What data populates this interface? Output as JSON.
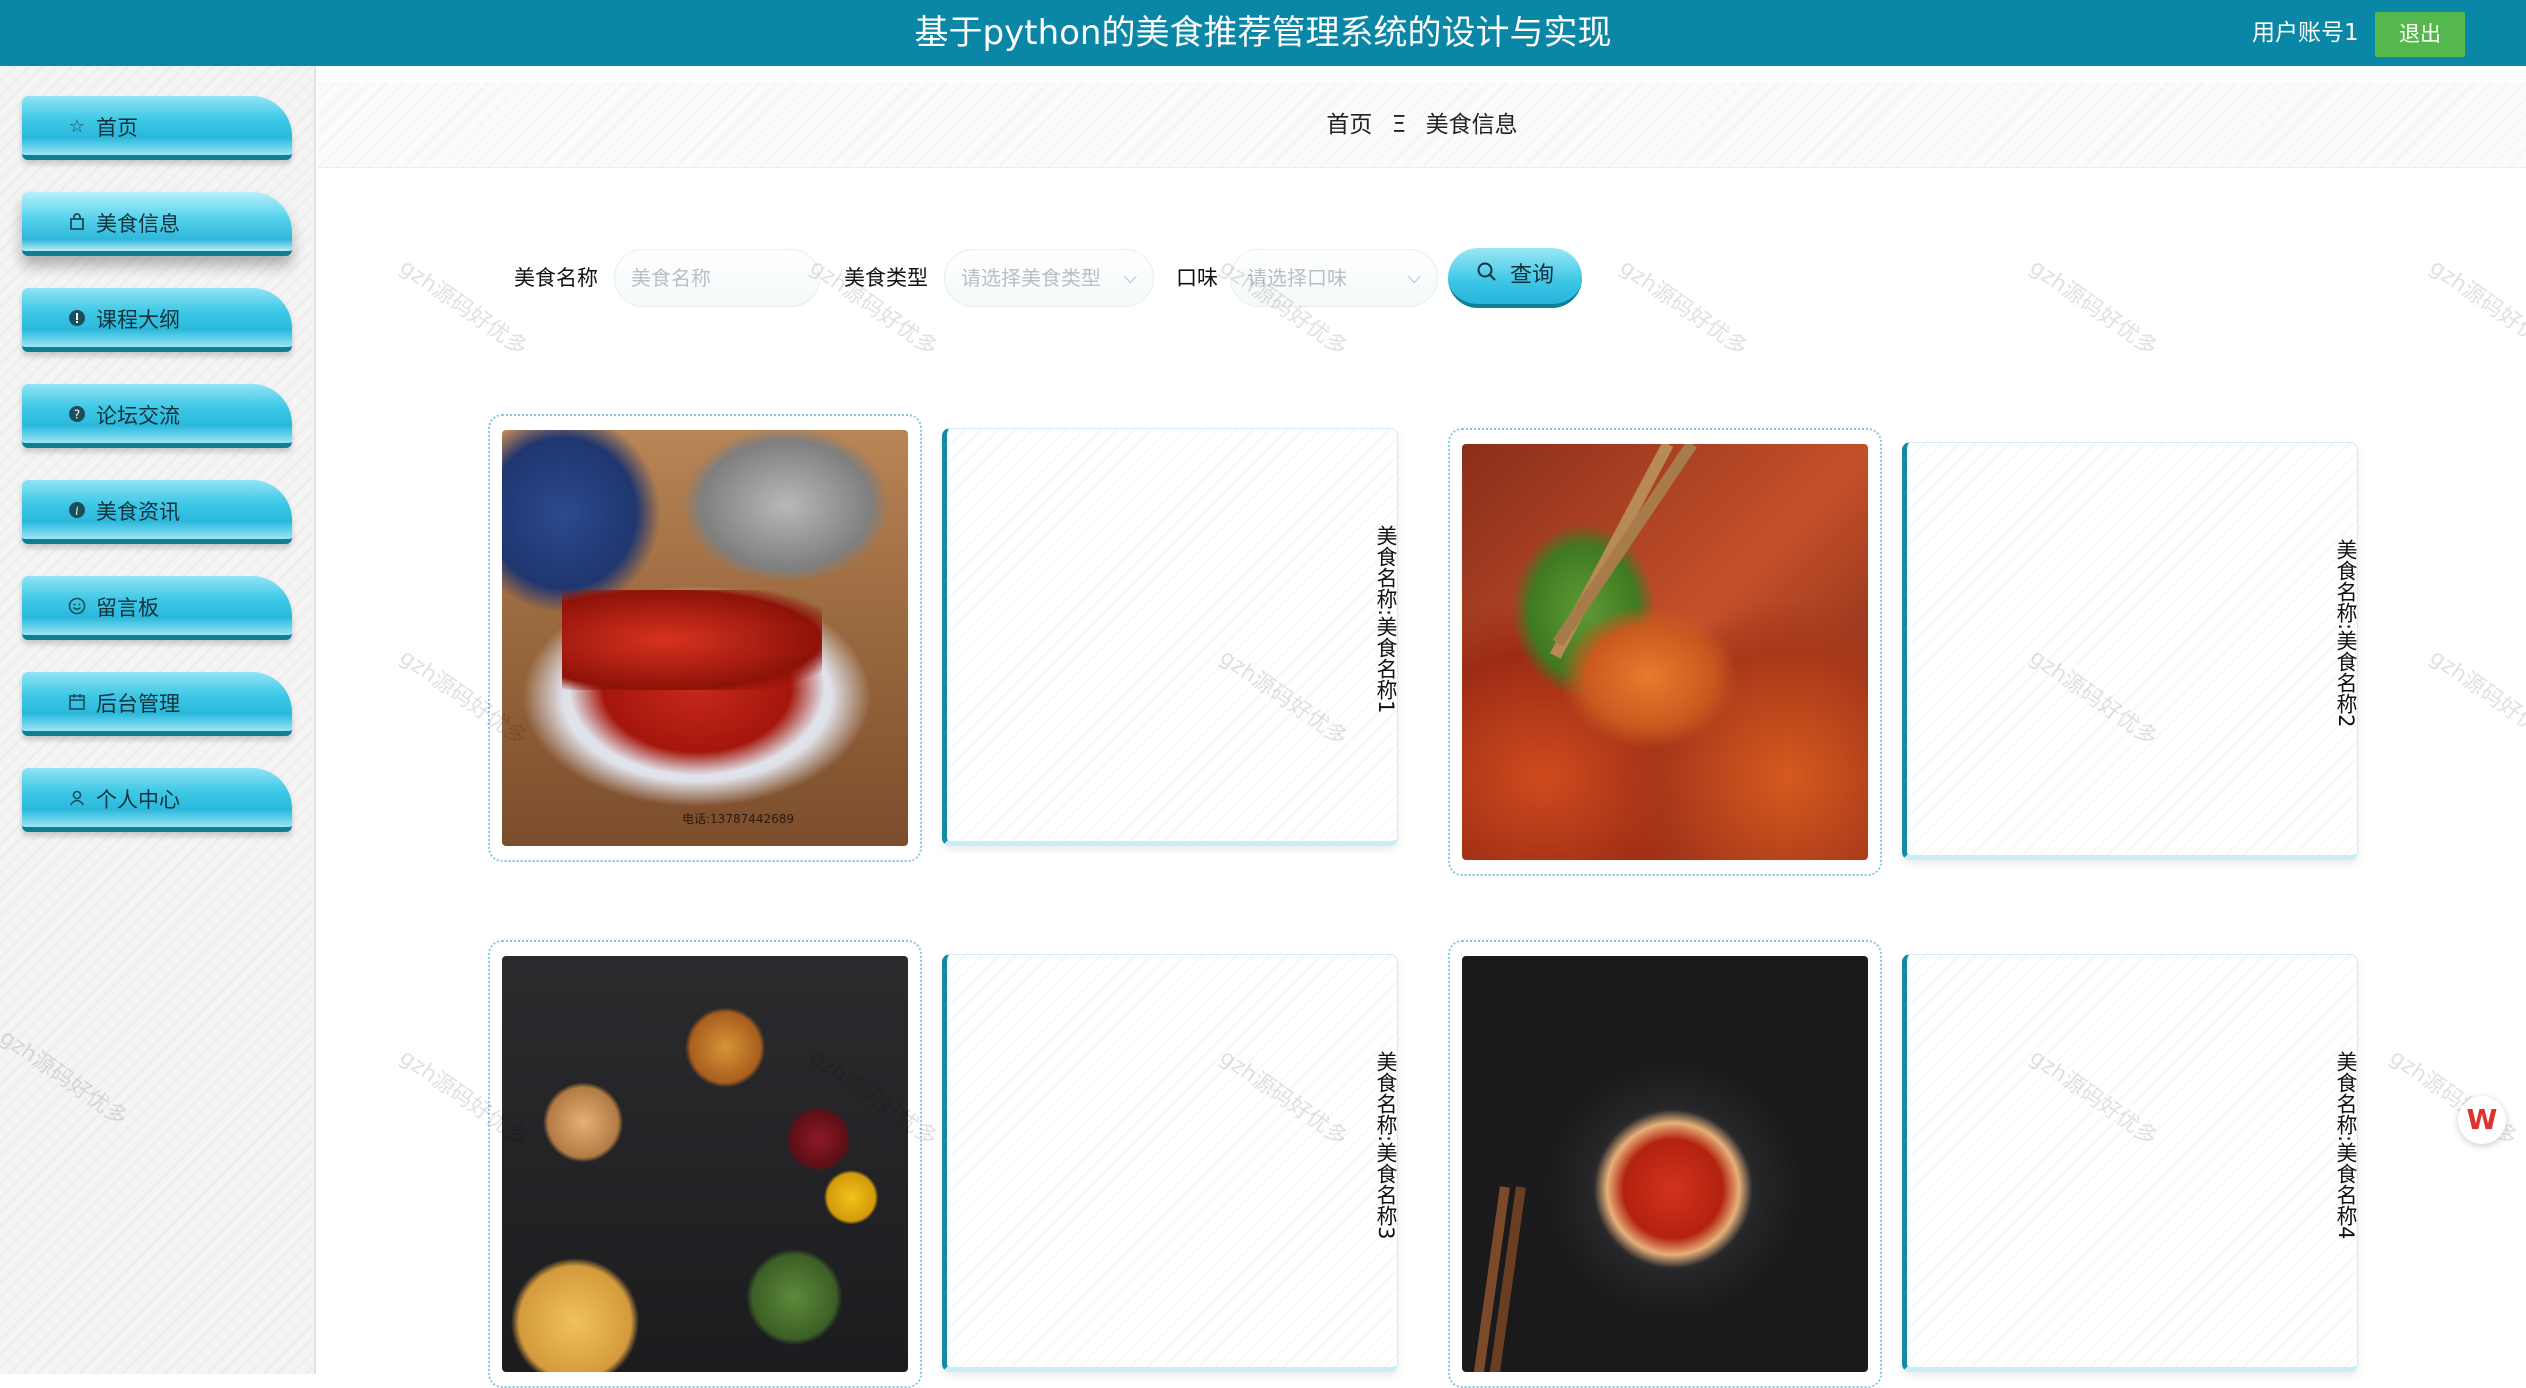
{
  "header": {
    "title": "基于python的美食推荐管理系统的设计与实现",
    "user_label": "用户账号1",
    "logout_label": "退出",
    "bg_color": "#0a86a6"
  },
  "sidebar": {
    "items": [
      {
        "label": "首页",
        "icon": "star-icon"
      },
      {
        "label": "美食信息",
        "icon": "bag-icon",
        "active": true
      },
      {
        "label": "课程大纲",
        "icon": "info-circle-icon"
      },
      {
        "label": "论坛交流",
        "icon": "question-circle-icon"
      },
      {
        "label": "美食资讯",
        "icon": "info-icon"
      },
      {
        "label": "留言板",
        "icon": "smile-icon"
      },
      {
        "label": "后台管理",
        "icon": "calendar-icon"
      },
      {
        "label": "个人中心",
        "icon": "user-icon"
      }
    ]
  },
  "breadcrumb": {
    "home": "首页",
    "separator": "Ξ",
    "current": "美食信息"
  },
  "search": {
    "name_label": "美食名称",
    "name_placeholder": "美食名称",
    "type_label": "美食类型",
    "type_placeholder": "请选择美食类型",
    "taste_label": "口味",
    "taste_placeholder": "请选择口味",
    "query_label": "查询"
  },
  "foods": [
    {
      "name": "美食名称:美食名称1",
      "image": "spicy-hot-pot-photo"
    },
    {
      "name": "美食名称:美食名称2",
      "image": "shrimp-chopsticks-photo"
    },
    {
      "name": "美食名称:美食名称3",
      "image": "food-spread-photo"
    },
    {
      "name": "美食名称:美食名称4",
      "image": "chili-hotpot-bowl-photo"
    }
  ],
  "photo_caption": "电话:13787442689",
  "watermark": "gzh源码好优多",
  "accent_color": "#2ab8dc"
}
